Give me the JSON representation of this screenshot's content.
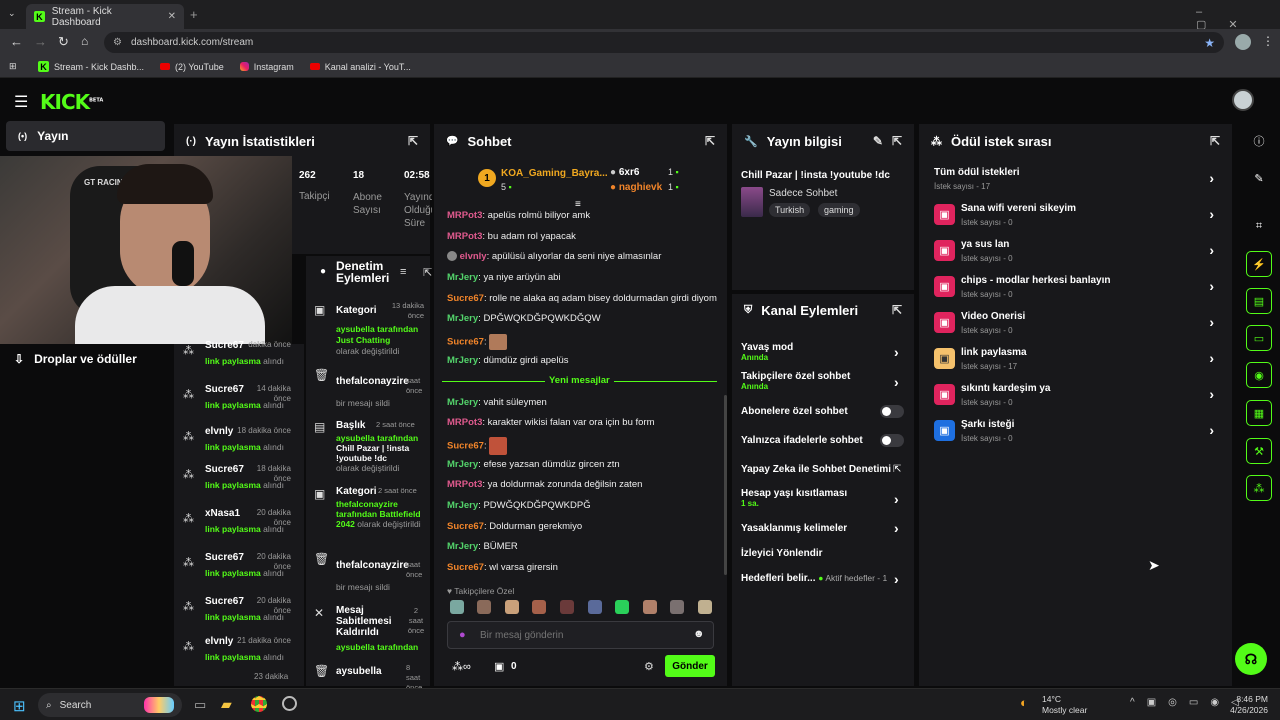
{
  "browser": {
    "tab_title": "Stream - Kick Dashboard",
    "url": "dashboard.kick.com/stream",
    "bookmarks": [
      "Stream - Kick Dashb...",
      "(2) YouTube",
      "Instagram",
      "Kanal analizi - YouT..."
    ]
  },
  "nav": {
    "logo": "KICK",
    "beta": "BETA",
    "items": [
      "Yayın",
      "Droplar ve ödüller"
    ]
  },
  "stats": {
    "title": "Yayın İstatistikleri",
    "items": [
      {
        "value": "262",
        "label": "Takipçi"
      },
      {
        "value": "18",
        "label": "Abone Sayısı"
      },
      {
        "value": "02:58",
        "label": "Yayında Olduğu Süre"
      }
    ]
  },
  "moderation": {
    "title": "Denetim Eylemleri",
    "items": [
      {
        "title": "Kategori",
        "time": "13 dakika önce",
        "line1": "aysubella tarafından",
        "line2": "Just Chatting",
        "line3": "olarak değiştirildi"
      },
      {
        "title": "thefalconayzire",
        "time": "saat önce",
        "line1": "bir mesajı sildi"
      },
      {
        "title": "Başlık",
        "time": "2 saat önce",
        "line1": "aysubella tarafından",
        "line2": "Chill Pazar | !insta !youtube !dc",
        "line3": "olarak değiştirildi"
      },
      {
        "title": "Kategori",
        "time": "2 saat önce",
        "line1": "thefalconayzire tarafından",
        "line2": "Battlefield 2042",
        "line3": "olarak değiştirildi"
      },
      {
        "title": "thefalconayzire",
        "time": "saat önce",
        "line1": "bir mesajı sildi"
      },
      {
        "title": "Mesaj Sabitlemesi Kaldırıldı",
        "time": "2 saat önce",
        "line1": "aysubella tarafından"
      },
      {
        "title": "aysubella",
        "time": "8 saat önce",
        "line1": ""
      }
    ]
  },
  "events": [
    {
      "name": "Sucre67",
      "time": "dakika önce",
      "action": "link paylasma",
      "suffix": "alındı"
    },
    {
      "name": "Sucre67",
      "time": "14 dakika önce",
      "action": "link paylasma",
      "suffix": "alındı"
    },
    {
      "name": "elvnly",
      "time": "18 dakika önce",
      "action": "link paylasma",
      "suffix": "alındı"
    },
    {
      "name": "Sucre67",
      "time": "18 dakika önce",
      "action": "link paylasma",
      "suffix": "alındı"
    },
    {
      "name": "xNasa1",
      "time": "20 dakika önce",
      "action": "link paylasma",
      "suffix": "alındı"
    },
    {
      "name": "Sucre67",
      "time": "20 dakika önce",
      "action": "link paylasma",
      "suffix": "alındı"
    },
    {
      "name": "Sucre67",
      "time": "20 dakika önce",
      "action": "link paylasma",
      "suffix": "alındı"
    },
    {
      "name": "elvnly",
      "time": "21 dakika önce",
      "action": "link paylasma",
      "suffix": "alındı"
    }
  ],
  "events_last_time": "23 dakika",
  "chat": {
    "title": "Sohbet",
    "top_supporter": {
      "rank": "1",
      "name": "KOA_Gaming_Bayra...",
      "count": "5"
    },
    "supporters": [
      {
        "name": "6xr6",
        "count": "1"
      },
      {
        "name": "naghievk",
        "count": "1"
      }
    ],
    "messages": [
      {
        "user": "MRPot3",
        "color": "r",
        "text": "apelüs rolmü biliyor amk"
      },
      {
        "user": "MRPot3",
        "color": "r",
        "text": "bu adam rol yapacak"
      },
      {
        "user": "elvnly",
        "color": "r",
        "text": "apülüsü alıyorlar da seni niye almasınlar"
      },
      {
        "user": "MrJery",
        "color": "g",
        "text": "ya niye arüyün abi"
      },
      {
        "user": "Sucre67",
        "color": "o",
        "text": "rolle ne alaka aq adam bisey doldurmadan girdi diyom"
      },
      {
        "user": "MrJery",
        "color": "g",
        "text": "DPĞWQKDĞPQWKDĞQW"
      },
      {
        "user": "Sucre67",
        "color": "o",
        "text": ""
      },
      {
        "user": "MrJery",
        "color": "g",
        "text": "dümdüz girdi apelüs"
      },
      {
        "user": "MrJery",
        "color": "g",
        "text": "vahit süleymen"
      },
      {
        "user": "MRPot3",
        "color": "r",
        "text": "karakter wikisi falan var ora için bu form"
      },
      {
        "user": "Sucre67",
        "color": "o",
        "text": ""
      },
      {
        "user": "MrJery",
        "color": "g",
        "text": "efese yazsan dümdüz gircen ztn"
      },
      {
        "user": "MRPot3",
        "color": "r",
        "text": "ya doldurmak zorunda değilsin zaten"
      },
      {
        "user": "MrJery",
        "color": "g",
        "text": "PDWĞQKDĞPQWKDPĞ"
      },
      {
        "user": "Sucre67",
        "color": "o",
        "text": "Doldurman gerekmiyo"
      },
      {
        "user": "MrJery",
        "color": "g",
        "text": "BÜMER"
      },
      {
        "user": "Sucre67",
        "color": "o",
        "text": "wl varsa girersin"
      }
    ],
    "new_messages": "Yeni mesajlar",
    "followers_only": "Takipçilere Özel",
    "input_placeholder": "Bir mesaj gönderin",
    "counter": "0",
    "send": "Gönder"
  },
  "stream_info": {
    "title": "Yayın bilgisi",
    "stream_title": "Chill Pazar | !insta !youtube !dc",
    "category": "Sadece Sohbet",
    "tags": [
      "Turkish",
      "gaming"
    ]
  },
  "channel_actions": {
    "title": "Kanal Eylemleri",
    "items": [
      {
        "label": "Yavaş mod",
        "sub": "Anında",
        "kind": "chevron"
      },
      {
        "label": "Takipçilere özel sohbet",
        "sub": "Anında",
        "kind": "chevron"
      },
      {
        "label": "Abonelere özel sohbet",
        "sub": "",
        "kind": "toggle"
      },
      {
        "label": "Yalnızca ifadelerle sohbet",
        "sub": "",
        "kind": "toggle"
      },
      {
        "label": "Yapay Zeka ile Sohbet Denetimi",
        "sub": "",
        "kind": "ext"
      },
      {
        "label": "Hesap yaşı kısıtlaması",
        "sub": "1 sa.",
        "kind": "chevron"
      },
      {
        "label": "Yasaklanmış kelimeler",
        "sub": "",
        "kind": "chevron"
      },
      {
        "label": "İzleyici Yönlendir",
        "sub": "",
        "kind": "none"
      },
      {
        "label": "Hedefleri belir...",
        "sub": "Aktif hedefler - 1",
        "kind": "chevron"
      }
    ]
  },
  "rewards": {
    "title": "Ödül istek sırası",
    "items": [
      {
        "title": "Tüm ödül istekleri",
        "sub": "İstek sayısı - 17",
        "color": "none"
      },
      {
        "title": "Sana wifi vereni sikeyim",
        "sub": "İstek sayısı - 0",
        "color": "#e0245e"
      },
      {
        "title": "ya sus lan",
        "sub": "İstek sayısı - 0",
        "color": "#e0245e"
      },
      {
        "title": "chips - modlar herkesi banlayın",
        "sub": "İstek sayısı - 0",
        "color": "#e0245e"
      },
      {
        "title": "Video Onerisi",
        "sub": "İstek sayısı - 0",
        "color": "#e0245e"
      },
      {
        "title": "link paylasma",
        "sub": "İstek sayısı - 17",
        "color": "#f5c16c"
      },
      {
        "title": "sıkıntı kardeşim ya",
        "sub": "İstek sayısı - 0",
        "color": "#e0245e"
      },
      {
        "title": "Şarkı isteği",
        "sub": "İstek sayısı - 0",
        "color": "#1e6fe0"
      }
    ]
  },
  "taskbar": {
    "search": "Search",
    "weather_temp": "14°C",
    "weather_text": "Mostly clear",
    "time": "8:46 PM",
    "date": "4/26/2026"
  }
}
